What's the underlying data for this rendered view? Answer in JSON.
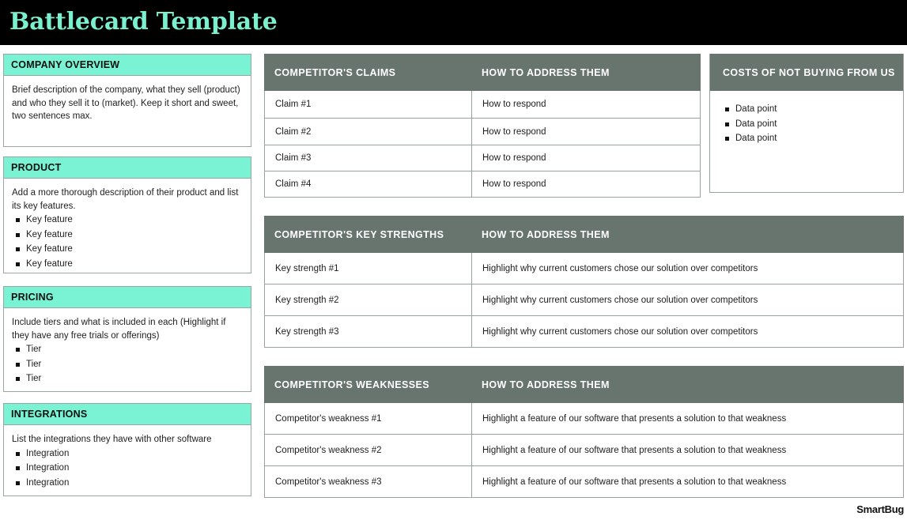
{
  "header": {
    "title": "Battlecard Template",
    "title_color": "#7af0cf",
    "background_color": "#000000"
  },
  "theme": {
    "accent_teal": "#79f3d4",
    "header_dark": "#68756f",
    "border_gray": "#98a29e"
  },
  "left_panels": [
    {
      "title": "COMPANY OVERVIEW",
      "body": "Brief description of the company, what they sell (product) and who they sell it to (market). Keep it short and sweet, two sentences max.",
      "bullets": []
    },
    {
      "title": "PRODUCT",
      "body": "Add a more thorough description of their product and list its key features.",
      "bullets": [
        "Key feature",
        "Key feature",
        "Key feature",
        "Key feature"
      ]
    },
    {
      "title": "PRICING",
      "body": "Include tiers and what is included in each (Highlight if they have any free trials or offerings)",
      "bullets": [
        "Tier",
        "Tier",
        "Tier"
      ]
    },
    {
      "title": "INTEGRATIONS",
      "body": "List the integrations they have with other software",
      "bullets": [
        "Integration",
        "Integration",
        "Integration"
      ]
    }
  ],
  "claims_table": {
    "columns": [
      "COMPETITOR'S CLAIMS",
      "HOW TO ADDRESS THEM"
    ],
    "rows": [
      [
        "Claim #1",
        "How to respond"
      ],
      [
        "Claim #2",
        "How to respond"
      ],
      [
        "Claim #3",
        "How to respond"
      ],
      [
        "Claim #4",
        "How to respond"
      ]
    ]
  },
  "costs_panel": {
    "title": "COSTS OF NOT BUYING FROM US",
    "bullets": [
      "Data point",
      "Data point",
      "Data point"
    ]
  },
  "strengths_table": {
    "columns": [
      "COMPETITOR'S KEY STRENGTHS",
      "HOW TO ADDRESS THEM"
    ],
    "rows": [
      [
        "Key strength #1",
        "Highlight why current customers chose our solution over competitors"
      ],
      [
        "Key strength #2",
        "Highlight why current  customers chose our solution over competitors"
      ],
      [
        "Key strength #3",
        "Highlight why current  customers chose our solution over competitors"
      ]
    ]
  },
  "weaknesses_table": {
    "columns": [
      "COMPETITOR'S WEAKNESSES",
      "HOW TO ADDRESS THEM"
    ],
    "rows": [
      [
        "Competitor's weakness #1",
        "Highlight a feature of our software that presents a solution to that weakness"
      ],
      [
        "Competitor's weakness #2",
        "Highlight a feature of our software that presents a solution to that weakness"
      ],
      [
        "Competitor's weakness #3",
        "Highlight a feature of our software that presents a solution to that weakness"
      ]
    ]
  },
  "footer": {
    "logo_text": "SmartBug"
  }
}
